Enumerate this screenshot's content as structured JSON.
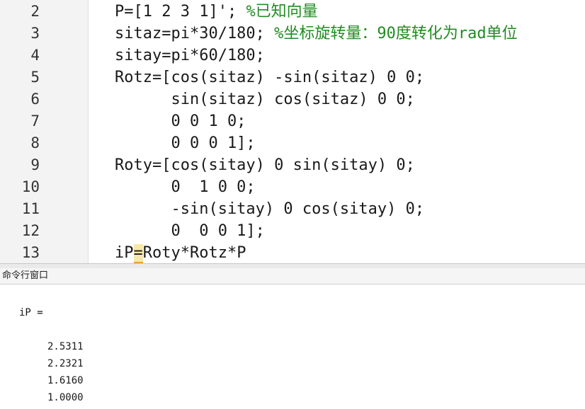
{
  "editor": {
    "lines": [
      {
        "no": "2",
        "code": "P=[1 2 3 1]'; ",
        "comment": "%已知向量"
      },
      {
        "no": "3",
        "code": "sitaz=pi*30/180; ",
        "comment": "%坐标旋转量：90度转化为rad单位"
      },
      {
        "no": "4",
        "code": "sitay=pi*60/180;",
        "comment": ""
      },
      {
        "no": "5",
        "code": "Rotz=[cos(sitaz) -sin(sitaz) 0 0;",
        "comment": ""
      },
      {
        "no": "6",
        "code": "      sin(sitaz) cos(sitaz) 0 0;",
        "comment": ""
      },
      {
        "no": "7",
        "code": "      0 0 1 0;",
        "comment": ""
      },
      {
        "no": "8",
        "code": "      0 0 0 1];",
        "comment": ""
      },
      {
        "no": "9",
        "code": "Roty=[cos(sitay) 0 sin(sitay) 0;",
        "comment": ""
      },
      {
        "no": "10",
        "code": "      0  1 0 0;",
        "comment": ""
      },
      {
        "no": "11",
        "code": "      -sin(sitay) 0 cos(sitay) 0;",
        "comment": ""
      },
      {
        "no": "12",
        "code": "      0  0 0 1];",
        "comment": ""
      }
    ],
    "last_line": {
      "no": "13",
      "before": "iP",
      "cursor_char": "=",
      "after": "Roty*Rotz*P"
    }
  },
  "command_window": {
    "title": "命令行窗口",
    "var_line": "iP =",
    "values": [
      "2.5311",
      "2.2321",
      "1.6160",
      "1.0000"
    ]
  }
}
